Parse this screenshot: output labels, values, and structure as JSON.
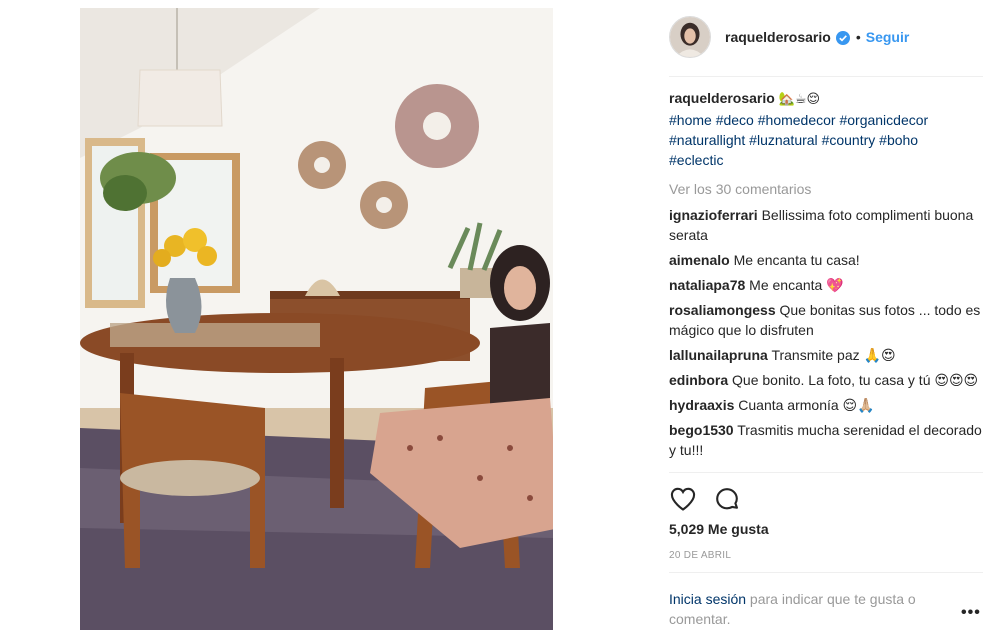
{
  "post": {
    "username": "raquelderosario",
    "follow_label": "Seguir",
    "separator": "•",
    "caption_user": "raquelderosario",
    "caption_emojis": "🏡☕😌",
    "hashtags": [
      "#home",
      "#deco",
      "#homedecor",
      "#organicdecor",
      "#naturallight",
      "#luznatural",
      "#country",
      "#boho",
      "#eclectic"
    ],
    "view_all": "Ver los 30 comentarios",
    "comments": [
      {
        "user": "ignazioferrari",
        "text": "Bellissima foto complimenti buona serata"
      },
      {
        "user": "aimenalo",
        "text": "Me encanta tu casa!"
      },
      {
        "user": "nataliapa78",
        "text": "Me encanta 💖"
      },
      {
        "user": "rosaliamongess",
        "text": "Que bonitas sus fotos ... todo es mágico que lo disfruten"
      },
      {
        "user": "lallunailapruna",
        "text": "Transmite paz 🙏😍"
      },
      {
        "user": "edinbora",
        "text": "Que bonito. La foto, tu casa y tú 😍😍😍"
      },
      {
        "user": "hydraaxis",
        "text": "Cuanta armonía 😌🙏🏼"
      },
      {
        "user": "bego1530",
        "text": "Trasmitis mucha serenidad el decorado y tu!!!"
      }
    ],
    "likes": "5,029 Me gusta",
    "date": "20 DE ABRIL",
    "login_link": "Inicia sesión",
    "login_text": " para indicar que te gusta o comentar.",
    "more_label": "•••"
  },
  "colors": {
    "link": "#003569",
    "accent": "#3897f0",
    "muted": "#999999",
    "text": "#262626"
  }
}
